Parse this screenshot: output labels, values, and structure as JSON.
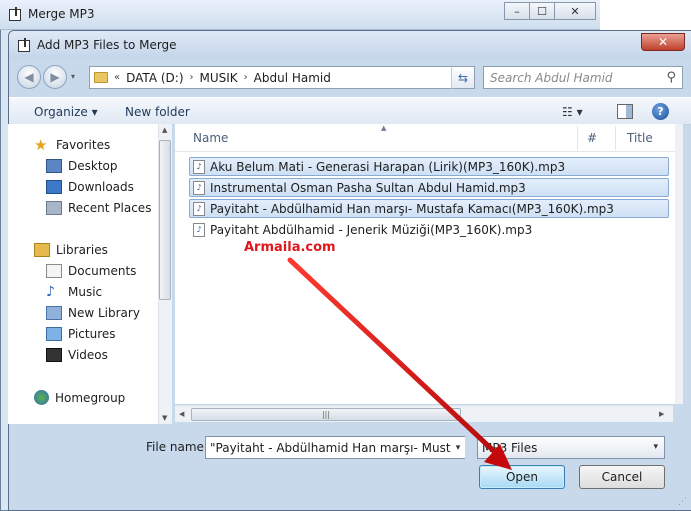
{
  "back_window": {
    "title": "Merge MP3",
    "minimize": "–",
    "maximize": "☐",
    "close": "✕"
  },
  "dialog": {
    "title": "Add MP3 Files to Merge",
    "close": "✕"
  },
  "address": {
    "segments": [
      "«",
      "DATA (D:)",
      "›",
      "MUSIK",
      "›",
      "Abdul Hamid"
    ],
    "dropdown": "▾",
    "refresh": "⇆"
  },
  "search": {
    "placeholder": "Search Abdul Hamid",
    "icon": "⚲"
  },
  "toolbar": {
    "organize": "Organize ▾",
    "new_folder": "New folder",
    "view": "☷ ▾",
    "help": "?"
  },
  "nav": {
    "favorites": "Favorites",
    "desktop": "Desktop",
    "downloads": "Downloads",
    "recent": "Recent Places",
    "libraries": "Libraries",
    "documents": "Documents",
    "music": "Music",
    "new_library": "New Library",
    "pictures": "Pictures",
    "videos": "Videos",
    "homegroup": "Homegroup"
  },
  "columns": {
    "name": "Name",
    "number": "#",
    "title": "Title"
  },
  "files": [
    "Aku Belum Mati - Generasi Harapan (Lirik)(MP3_160K).mp3",
    "Instrumental Osman Pasha Sultan Abdul Hamid.mp3",
    "Payitaht - Abdülhamid Han marşı- Mustafa Kamacı(MP3_160K).mp3",
    "Payitaht Abdülhamid - Jenerik Müziği(MP3_160K).mp3"
  ],
  "watermark": "Armaila.com",
  "bottom": {
    "file_name_label": "File name:",
    "file_name_value": "\"Payitaht - Abdülhamid Han marşı- Mustafa",
    "file_type": "MP3 Files",
    "open": "Open",
    "cancel": "Cancel"
  },
  "colors": {
    "selection": "#cfe0f5",
    "annotation_arrow": "#e0161b"
  }
}
